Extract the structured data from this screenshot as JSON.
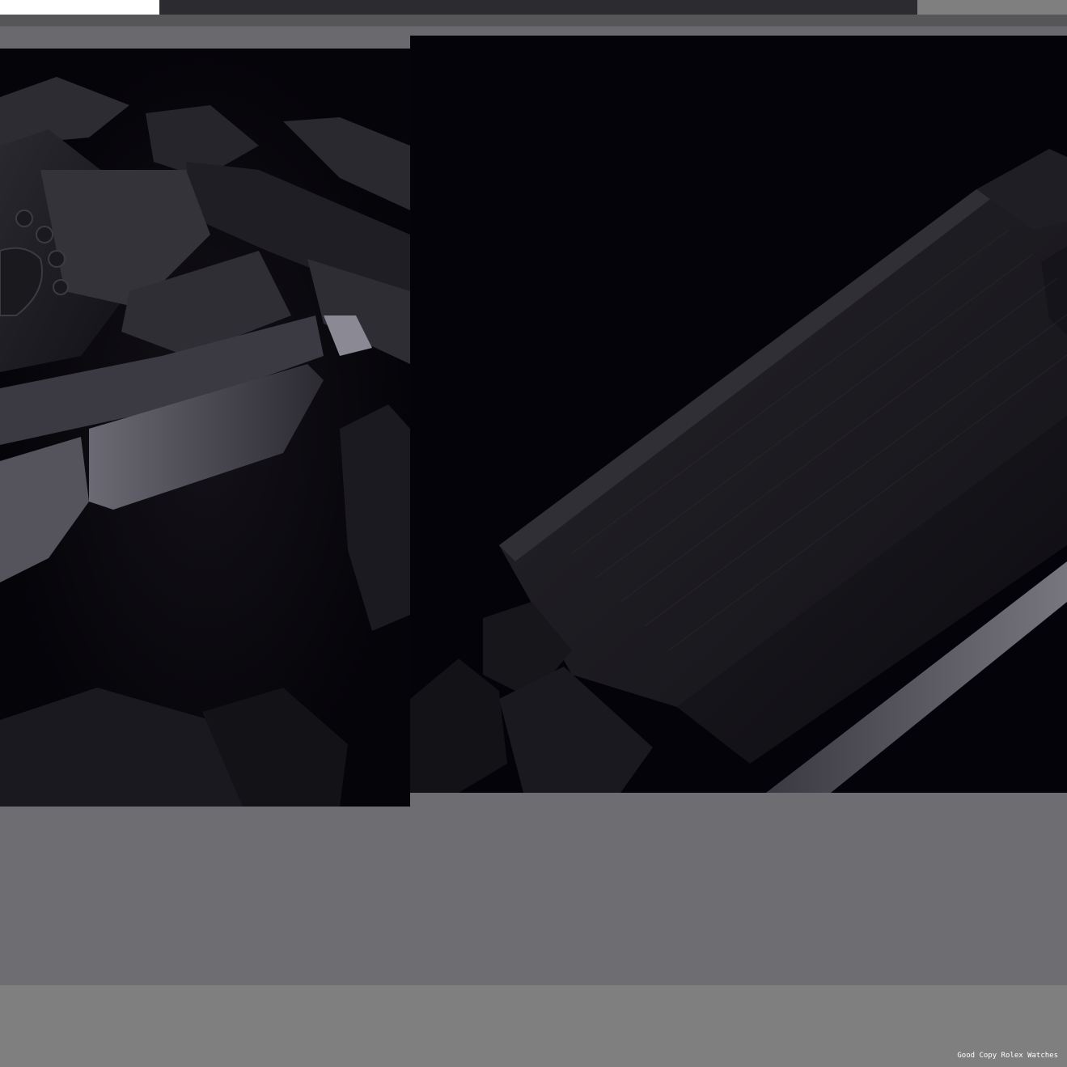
{
  "caption": {
    "text": "Good Copy Rolex Watches"
  },
  "colors": {
    "background_dark": "#05040a",
    "metal_dark": "#1c1b20",
    "metal_light": "#5e5d66",
    "gray_panel": "#6e6e72",
    "gray_bottom": "#7f7f7f",
    "caption_text": "#ffffff"
  },
  "photos": [
    {
      "subject": "black bracelet clasp with crown logo, close-up"
    },
    {
      "subject": "black brushed bracelet clasp blade, close-up"
    }
  ]
}
